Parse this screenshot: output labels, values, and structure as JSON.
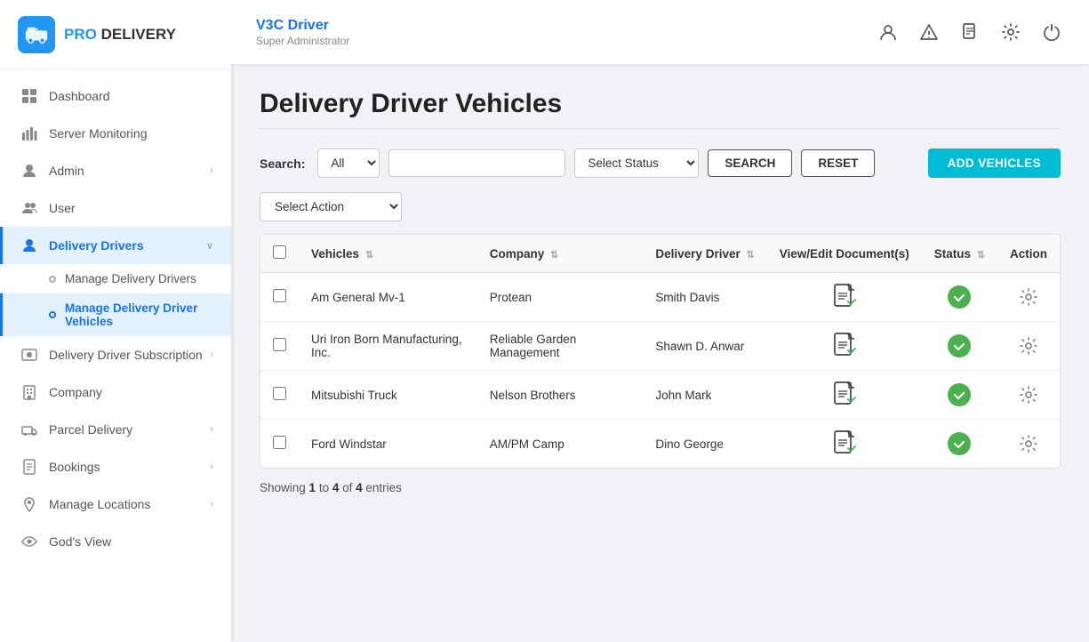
{
  "logo": {
    "brand": "PRO",
    "brand2": "DELIVERY"
  },
  "sidebar": {
    "items": [
      {
        "id": "dashboard",
        "label": "Dashboard",
        "icon": "grid"
      },
      {
        "id": "server-monitoring",
        "label": "Server Monitoring",
        "icon": "chart"
      },
      {
        "id": "admin",
        "label": "Admin",
        "icon": "person",
        "hasChevron": true
      },
      {
        "id": "user",
        "label": "User",
        "icon": "person-group"
      },
      {
        "id": "delivery-drivers",
        "label": "Delivery Drivers",
        "icon": "person-pin",
        "hasChevron": true,
        "active": true,
        "children": [
          {
            "id": "manage-delivery-drivers",
            "label": "Manage Delivery Drivers",
            "active": false
          },
          {
            "id": "manage-delivery-driver-vehicles",
            "label": "Manage Delivery Driver Vehicles",
            "active": true
          }
        ]
      },
      {
        "id": "delivery-driver-subscription",
        "label": "Delivery Driver Subscription",
        "icon": "subscription",
        "hasChevron": true
      },
      {
        "id": "company",
        "label": "Company",
        "icon": "building"
      },
      {
        "id": "parcel-delivery",
        "label": "Parcel Delivery",
        "icon": "truck",
        "hasChevron": true
      },
      {
        "id": "bookings",
        "label": "Bookings",
        "icon": "notebook",
        "hasChevron": true
      },
      {
        "id": "manage-locations",
        "label": "Manage Locations",
        "icon": "location",
        "hasChevron": true
      },
      {
        "id": "gods-view",
        "label": "God's View",
        "icon": "eye"
      }
    ]
  },
  "topbar": {
    "driver_name": "V3C Driver",
    "role": "Super Administrator",
    "icons": [
      "person",
      "warning",
      "document",
      "gear",
      "power"
    ]
  },
  "page": {
    "title": "Delivery Driver Vehicles"
  },
  "search": {
    "label": "Search:",
    "filter_options": [
      "All"
    ],
    "filter_value": "All",
    "input_placeholder": "",
    "status_placeholder": "Select Status",
    "search_btn": "SEARCH",
    "reset_btn": "RESET",
    "add_btn": "ADD VEHICLES"
  },
  "action": {
    "placeholder": "Select Action"
  },
  "table": {
    "columns": [
      "",
      "Vehicles",
      "Company",
      "Delivery Driver",
      "View/Edit Document(s)",
      "Status",
      "Action"
    ],
    "rows": [
      {
        "id": 1,
        "vehicle": "Am General Mv-1",
        "company": "Protean",
        "driver": "Smith Davis"
      },
      {
        "id": 2,
        "vehicle": "Uri Iron Born Manufacturing, Inc.",
        "company": "Reliable Garden Management",
        "driver": "Shawn D. Anwar"
      },
      {
        "id": 3,
        "vehicle": "Mitsubishi Truck",
        "company": "Nelson Brothers",
        "driver": "John Mark"
      },
      {
        "id": 4,
        "vehicle": "Ford Windstar",
        "company": "AM/PM Camp",
        "driver": "Dino George"
      }
    ]
  },
  "pagination": {
    "showing_prefix": "Showing ",
    "from": "1",
    "to_prefix": " to ",
    "to": "4",
    "of_prefix": " of ",
    "total": "4",
    "entries_suffix": " entries"
  }
}
